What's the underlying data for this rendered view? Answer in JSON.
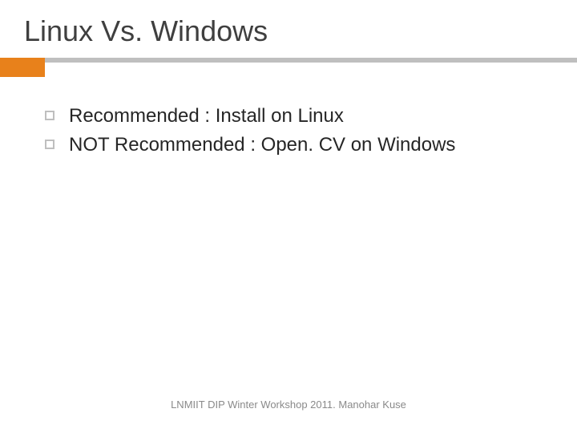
{
  "slide": {
    "title": "Linux Vs. Windows",
    "bullets": [
      "Recommended : Install on Linux",
      "NOT Recommended : Open. CV on Windows"
    ],
    "footer": "LNMIIT DIP Winter Workshop 2011. Manohar Kuse"
  },
  "colors": {
    "accent": "#e8811b",
    "underline": "#bfbfbf"
  }
}
